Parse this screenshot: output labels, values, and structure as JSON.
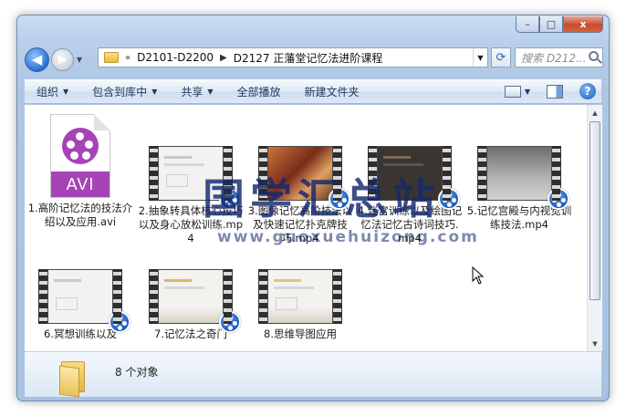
{
  "window": {
    "caption_buttons": {
      "minimize": "–",
      "maximize": "□",
      "close": "x"
    }
  },
  "navigation": {
    "back_glyph": "◀",
    "forward_glyph": "▶",
    "breadcrumb_sep": "«",
    "crumbs": [
      "D2101-D2200",
      "D2127 正藩堂记忆法进阶课程"
    ],
    "crumb_arrow": "▶",
    "search_placeholder": "搜索 D212..."
  },
  "toolbar": {
    "items": [
      {
        "label": "组织",
        "dropdown": true
      },
      {
        "label": "包含到库中",
        "dropdown": true
      },
      {
        "label": "共享",
        "dropdown": true
      },
      {
        "label": "全部播放",
        "dropdown": false
      },
      {
        "label": "新建文件夹",
        "dropdown": false
      }
    ],
    "help": "?"
  },
  "files": [
    {
      "name": "1.高阶记忆法的技法介绍以及应用.avi",
      "kind": "avi",
      "badge": "AVI"
    },
    {
      "name": "2.抽象转具体核心技巧以及身心放松训练.mp4",
      "kind": "mp4"
    },
    {
      "name": "3.图像记忆高阶技法以及快速记忆扑克牌技巧.mp4",
      "kind": "mp4"
    },
    {
      "name": "4.迷宫训练以及绘图记忆法记忆古诗词技巧.mp4",
      "kind": "mp4"
    },
    {
      "name": "5.记忆宫殿与内视觉训练技法.mp4",
      "kind": "mp4"
    },
    {
      "name": "6.冥想训练以及",
      "kind": "mp4"
    },
    {
      "name": "7.记忆法之奇门",
      "kind": "mp4"
    },
    {
      "name": "8.思维导图应用",
      "kind": "mp4"
    }
  ],
  "watermark": {
    "main": "国学汇总站",
    "url": "www.guoxuehuizong.com"
  },
  "details": {
    "count_text": "8 个对象"
  },
  "colors": {
    "accent": "#1e395b",
    "avi_purple": "#a544b7",
    "player_blue": "#1d58b8"
  }
}
